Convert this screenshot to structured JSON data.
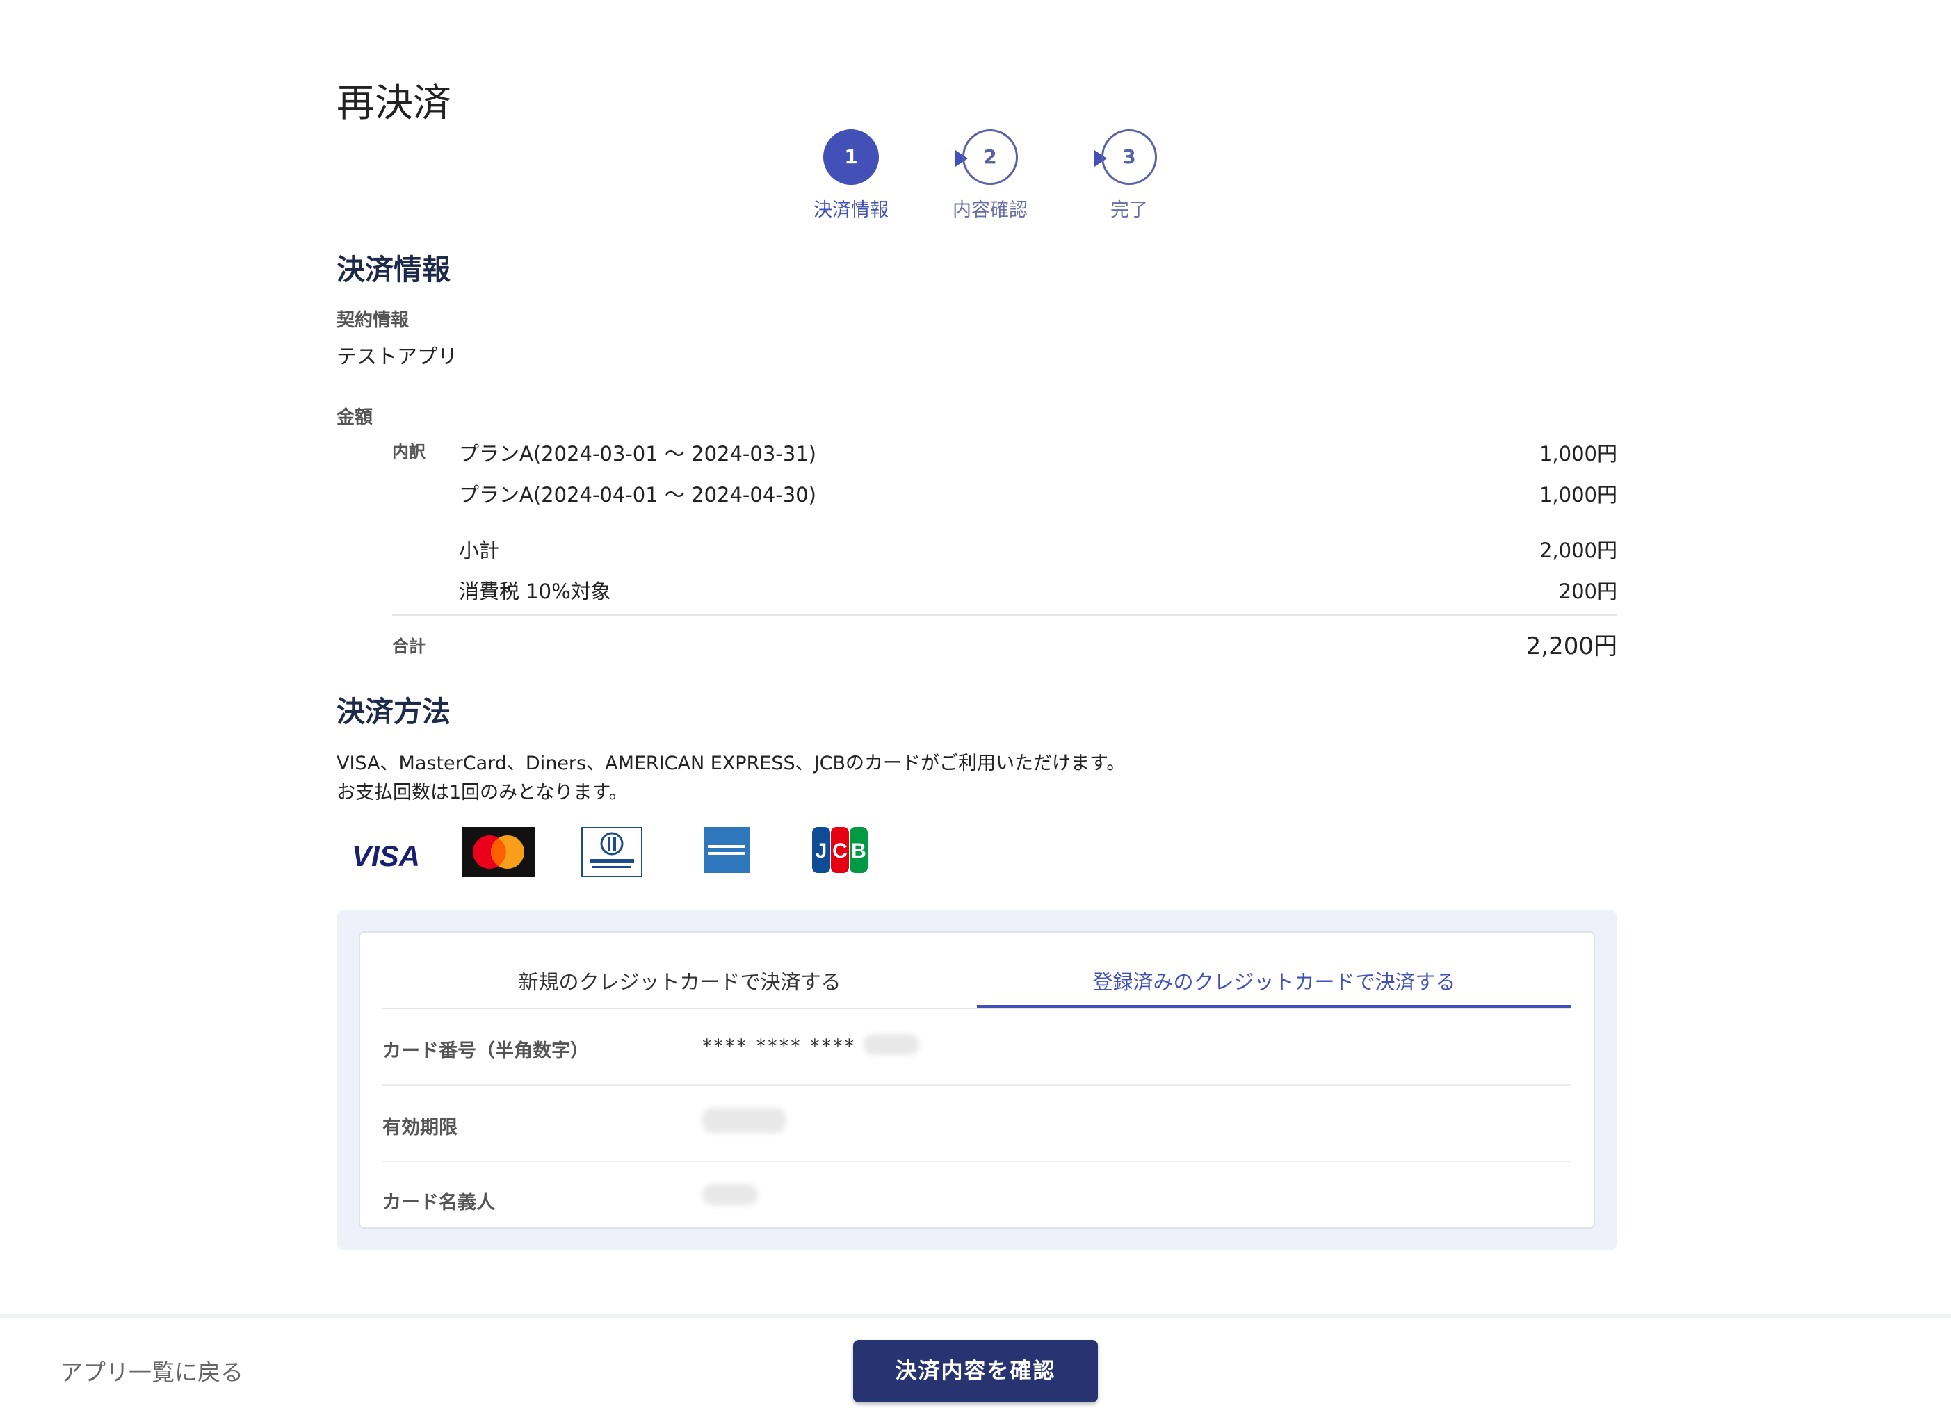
{
  "page_title": "再決済",
  "stepper": {
    "steps": [
      {
        "num": "1",
        "label": "決済情報"
      },
      {
        "num": "2",
        "label": "内容確認"
      },
      {
        "num": "3",
        "label": "完了"
      }
    ],
    "accent_color": "#4350b8"
  },
  "payment_info": {
    "heading": "決済情報",
    "contract_label": "契約情報",
    "contract_value": "テストアプリ",
    "amount_label": "金額",
    "breakdown_label": "内訳",
    "items": [
      {
        "name": "プランA(2024-03-01 ～ 2024-03-31)",
        "price": "1,000円"
      },
      {
        "name": "プランA(2024-04-01 ～ 2024-04-30)",
        "price": "1,000円"
      }
    ],
    "subtotal_label": "小計",
    "subtotal": "2,000円",
    "tax_label": "消費税 10%対象",
    "tax": "200円",
    "total_label": "合計",
    "total": "2,200円"
  },
  "payment_method": {
    "heading": "決済方法",
    "desc_line1": "VISA、MasterCard、Diners、AMERICAN EXPRESS、JCBのカードがご利用いただけます。",
    "desc_line2": "お支払回数は1回のみとなります。",
    "brands": [
      {
        "name": "VISA",
        "icon": "visa-logo"
      },
      {
        "name": "MasterCard",
        "icon": "mastercard-logo"
      },
      {
        "name": "Diners Club",
        "icon": "diners-logo"
      },
      {
        "name": "AMERICAN EXPRESS",
        "icon": "amex-logo"
      },
      {
        "name": "JCB",
        "icon": "jcb-logo"
      }
    ],
    "tabs": [
      {
        "label": "新規のクレジットカードで決済する",
        "selected": false
      },
      {
        "label": "登録済みのクレジットカードで決済する",
        "selected": true
      }
    ],
    "card_number_label": "カード番号（半角数字）",
    "card_number_value": "**** **** ****",
    "expiry_label": "有効期限",
    "holder_label": "カード名義人"
  },
  "footer": {
    "back_link": "アプリ一覧に戻る",
    "confirm_button": "決済内容を確認"
  }
}
